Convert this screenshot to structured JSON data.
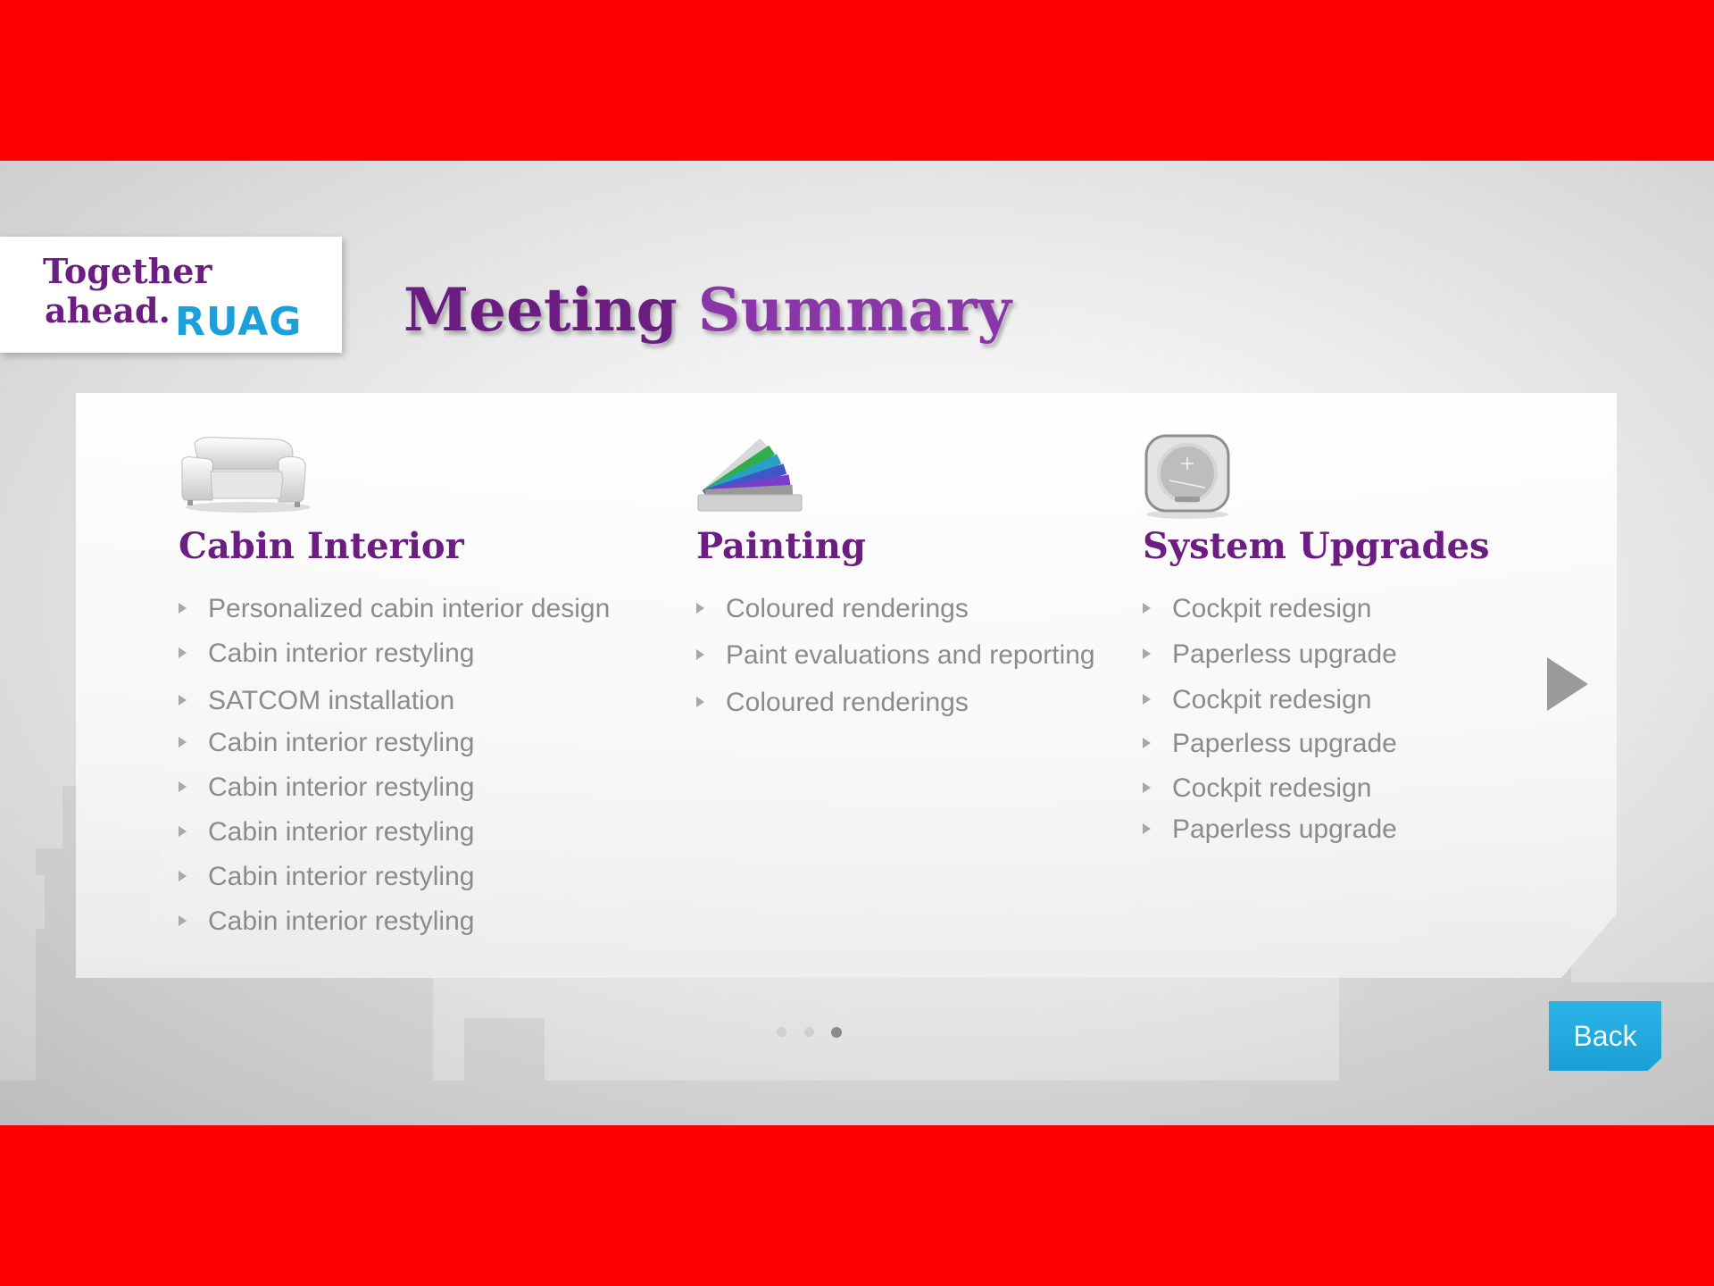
{
  "logo": {
    "line1": "Together",
    "line2": "ahead.",
    "brand": "RUAG"
  },
  "title": {
    "word1": "Meeting",
    "word2": "Summary"
  },
  "columns": [
    {
      "icon": "armchair-icon",
      "title": "Cabin Interior",
      "items": [
        "Personalized cabin interior design",
        "Cabin interior restyling",
        "SATCOM installation",
        "Cabin interior restyling",
        "Cabin interior restyling",
        "Cabin interior restyling",
        "Cabin interior restyling",
        "Cabin interior restyling"
      ]
    },
    {
      "icon": "color-swatch-icon",
      "title": "Painting",
      "items": [
        "Coloured renderings",
        "Paint evaluations and reporting",
        "Coloured renderings"
      ]
    },
    {
      "icon": "cockpit-instrument-icon",
      "title": "System Upgrades",
      "items": [
        "Cockpit redesign",
        "Paperless upgrade",
        "Cockpit redesign",
        "Paperless upgrade",
        "Cockpit redesign",
        "Paperless upgrade"
      ]
    }
  ],
  "pagination": {
    "total": 3,
    "active": 3
  },
  "back_label": "Back",
  "colors": {
    "frame": "#ff0000",
    "accent_purple": "#6b1d82",
    "brand_blue": "#1ba0dc",
    "item_text": "#8b8b8b"
  }
}
